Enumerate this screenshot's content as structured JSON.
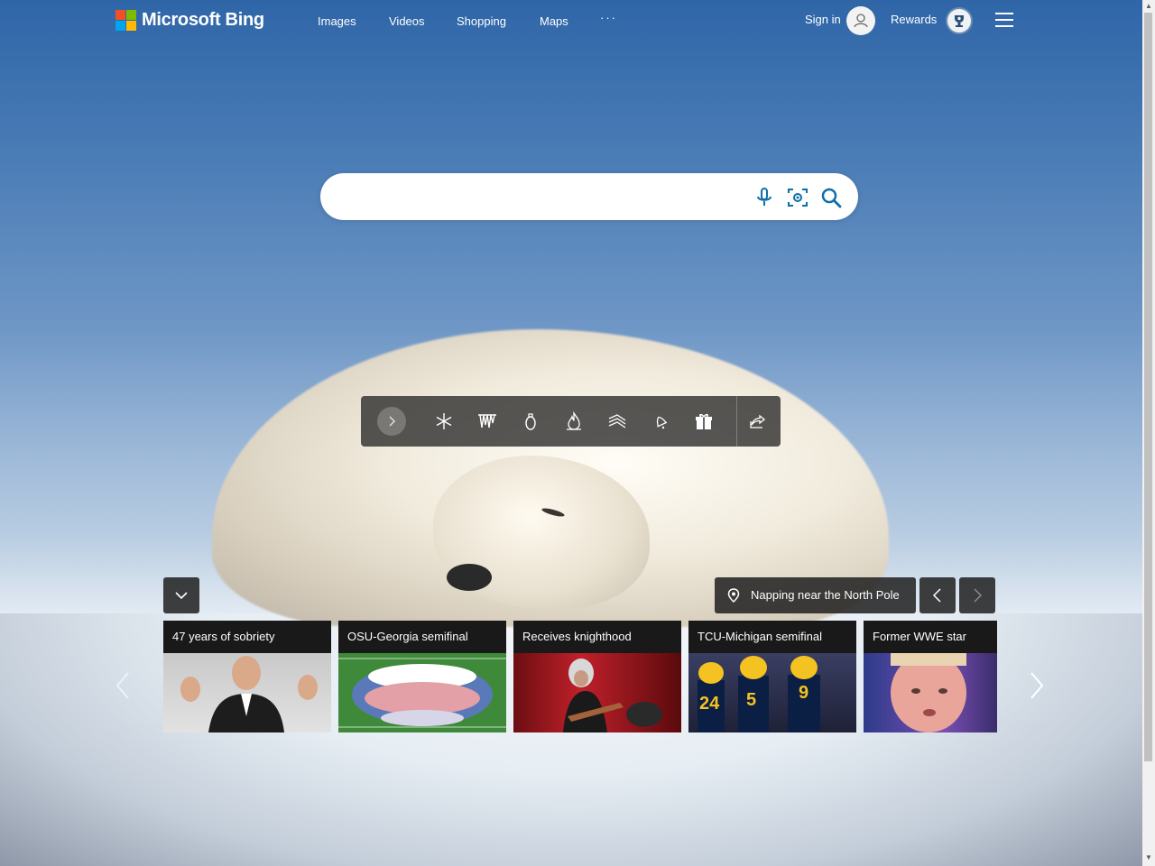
{
  "header": {
    "brand": "Microsoft Bing",
    "nav": [
      "Images",
      "Videos",
      "Shopping",
      "Maps"
    ],
    "more": "···",
    "signin": "Sign in",
    "rewards": "Rewards"
  },
  "search": {
    "value": "",
    "placeholder": ""
  },
  "toolbar": {
    "icons": [
      "expand-icon",
      "snowflake-icon",
      "icicles-icon",
      "ornament-icon",
      "fire-icon",
      "snow-drift-icon",
      "bell-icon",
      "gift-icon",
      "share-icon"
    ]
  },
  "location": {
    "label": "Napping near the North Pole"
  },
  "news": [
    {
      "title": "47 years of sobriety"
    },
    {
      "title": "OSU-Georgia semifinal"
    },
    {
      "title": "Receives knighthood"
    },
    {
      "title": "TCU-Michigan semifinal"
    },
    {
      "title": "Former WWE star"
    }
  ],
  "colors": {
    "brand_red": "#f25022",
    "brand_green": "#7fba00",
    "brand_blue": "#00a4ef",
    "brand_yellow": "#ffb900",
    "search_icon": "#0c6fa8"
  }
}
